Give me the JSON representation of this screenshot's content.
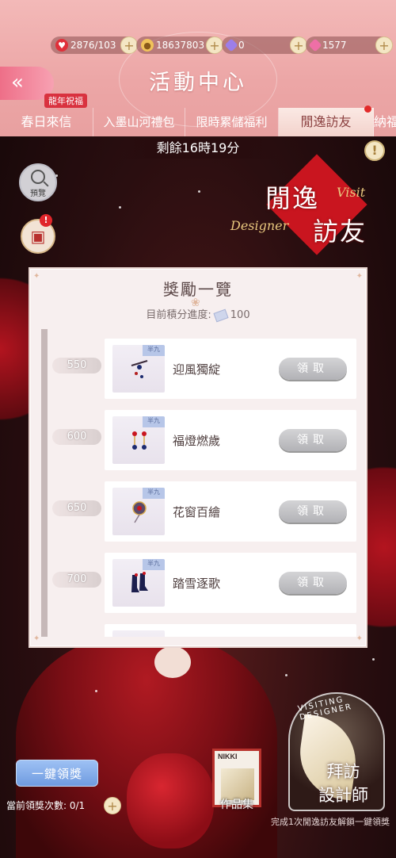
{
  "resources": {
    "stamina": "2876/103",
    "gold": "18637803",
    "diamond": "0",
    "crystal": "1577"
  },
  "header": {
    "back_label": "«",
    "title": "活動中心",
    "tab_badge": "龍年祝福"
  },
  "tabs": [
    {
      "label": "春日來信"
    },
    {
      "label": "入墨山河禮包"
    },
    {
      "label": "限時累儲福利"
    },
    {
      "label": "閒逸訪友"
    },
    {
      "label": "納福"
    }
  ],
  "timer": "剩餘16時19分",
  "preview_label": "預覽",
  "event_logo": {
    "line1": "閒逸",
    "line2": "訪友",
    "script1": "Visit",
    "script2": "Designer"
  },
  "rewards_panel": {
    "title": "獎勵一覽",
    "progress_label": "目前積分進度:",
    "progress_value": "100",
    "items": [
      {
        "score": "550",
        "name": "迎風獨綻",
        "button": "領取",
        "corner": "半九"
      },
      {
        "score": "600",
        "name": "福燈燃歲",
        "button": "領取",
        "corner": "半九"
      },
      {
        "score": "650",
        "name": "花窗百繪",
        "button": "領取",
        "corner": "半九"
      },
      {
        "score": "700",
        "name": "踏雪逐歌",
        "button": "領取",
        "corner": "半九"
      }
    ]
  },
  "bottom": {
    "claim_all": "一鍵領獎",
    "claim_count_label": "當前領獎次數: 0/1",
    "portfolio_card_text": "NIKKI",
    "portfolio_label": "作品集",
    "visit_arc": "VISITING DESIGNER",
    "visit_label_line1": "拜訪",
    "visit_label_line2": "設計師",
    "note": "完成1次閒逸訪友解鎖一鍵領獎"
  },
  "colors": {
    "header_pink": "#eca6a6",
    "accent_red": "#c9151f",
    "claim_all_blue": "#6f9be0"
  }
}
